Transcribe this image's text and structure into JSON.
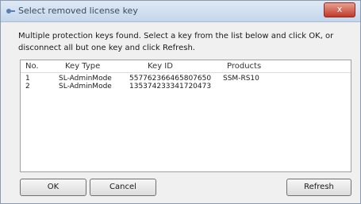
{
  "window": {
    "title": "Select removed license key",
    "close_label": "x"
  },
  "message": "Multiple protection keys found. Select a key from the list below and click OK, or disconnect all but one key and click Refresh.",
  "table": {
    "columns": [
      "No.",
      "Key Type",
      "Key ID",
      "Products"
    ],
    "rows": [
      [
        "1",
        "SL-AdminMode",
        "557762366465807650",
        "SSM-RS10"
      ],
      [
        "2",
        "SL-AdminMode",
        "135374233341720473",
        ""
      ]
    ]
  },
  "buttons": {
    "ok": "OK",
    "cancel": "Cancel",
    "refresh": "Refresh"
  },
  "icon": {
    "title": "key-app-icon"
  }
}
